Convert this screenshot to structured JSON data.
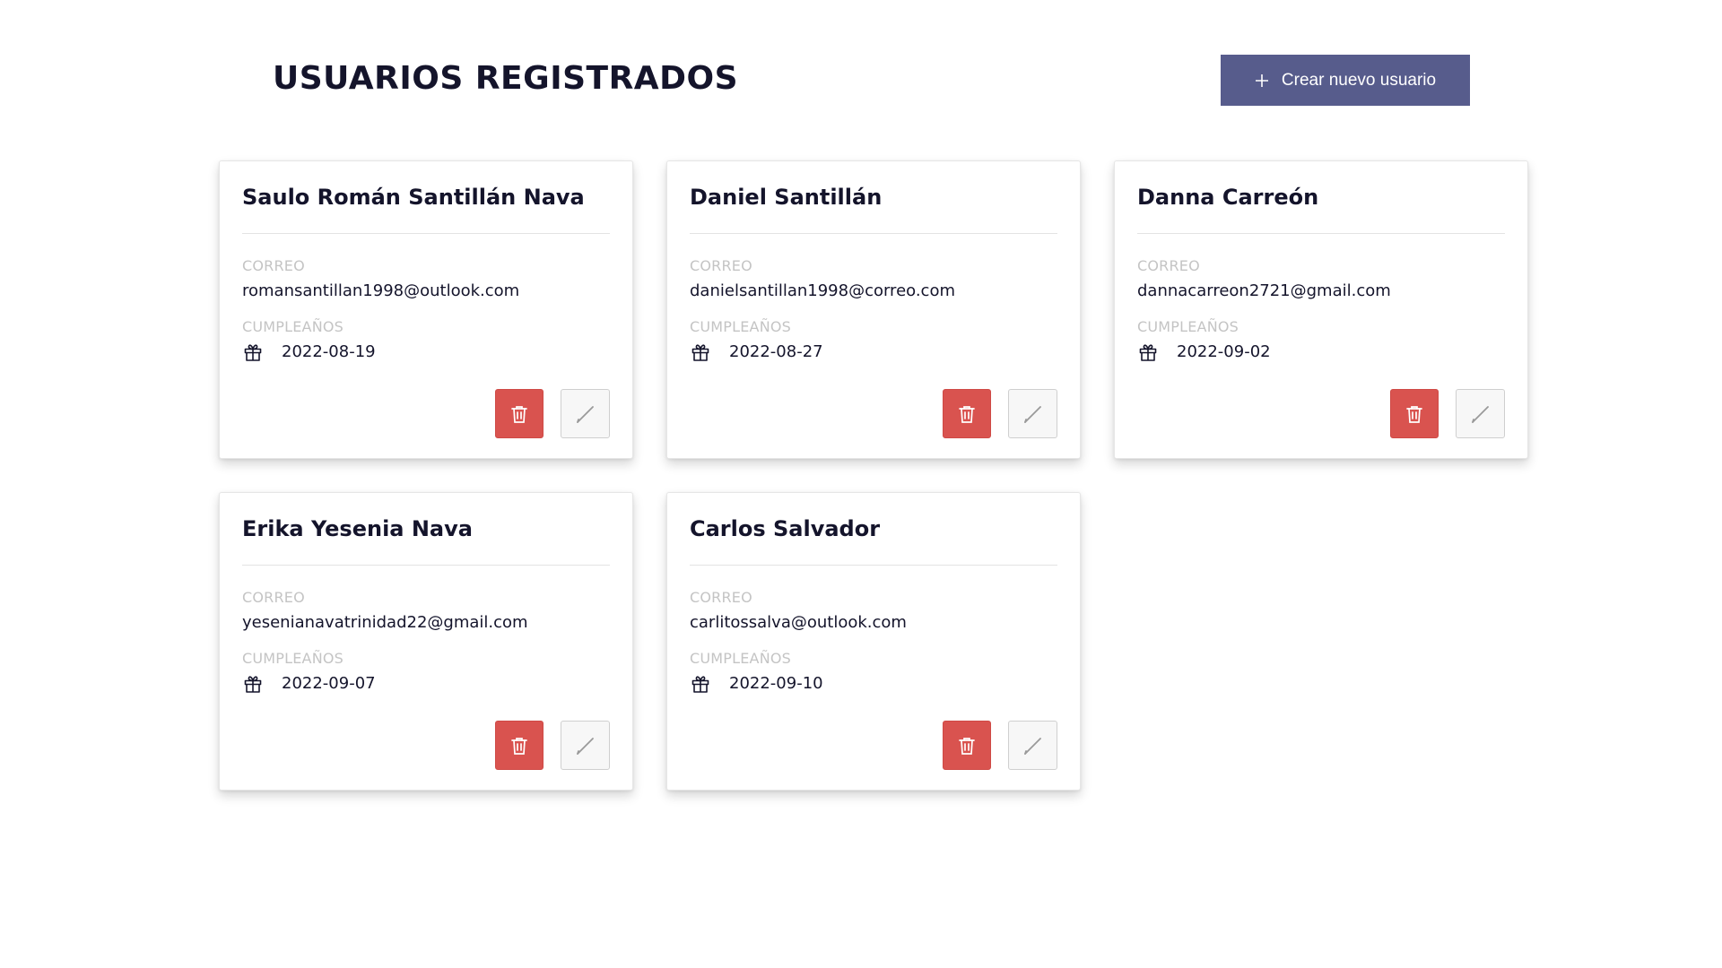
{
  "header": {
    "title": "USUARIOS REGISTRADOS",
    "create_button_label": "Crear nuevo usuario",
    "create_button_color": "#575c8c"
  },
  "labels": {
    "email": "CORREO",
    "birthday": "CUMPLEAÑOS"
  },
  "colors": {
    "delete_button": "#d9534f",
    "edit_button": "#f7f7f7",
    "title_text": "#14142b",
    "label_text": "#c4c4c4"
  },
  "icons": {
    "create": "plus-icon",
    "birthday": "gift-icon",
    "delete": "trash-icon",
    "edit": "pencil-icon"
  },
  "users": [
    {
      "name": "Saulo Román Santillán Nava",
      "email": "romansantillan1998@outlook.com",
      "birthday": "2022-08-19"
    },
    {
      "name": "Daniel Santillán",
      "email": "danielsantillan1998@correo.com",
      "birthday": "2022-08-27"
    },
    {
      "name": "Danna Carreón",
      "email": "dannacarreon2721@gmail.com",
      "birthday": "2022-09-02"
    },
    {
      "name": "Erika Yesenia Nava",
      "email": "yesenianavatrinidad22@gmail.com",
      "birthday": "2022-09-07"
    },
    {
      "name": "Carlos Salvador",
      "email": "carlitossalva@outlook.com",
      "birthday": "2022-09-10"
    }
  ]
}
